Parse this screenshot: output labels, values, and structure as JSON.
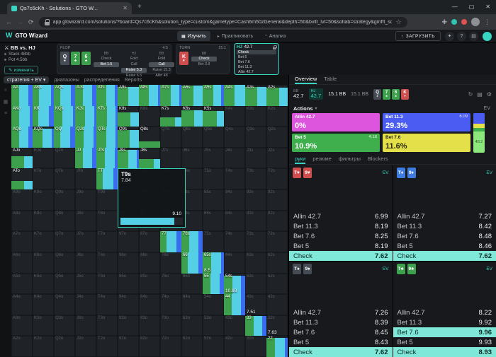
{
  "browser": {
    "tab_title": "Qs7c6cKh - Solutions - GTO W...",
    "new_tab_label": "+",
    "window_controls": [
      {
        "name": "minimize-button",
        "glyph": "—"
      },
      {
        "name": "maximize-button",
        "glyph": "▢"
      },
      {
        "name": "close-button",
        "glyph": "✕"
      }
    ],
    "nav_icons": [
      {
        "name": "back-icon",
        "glyph": "←",
        "dim": false
      },
      {
        "name": "forward-icon",
        "glyph": "→",
        "dim": true
      },
      {
        "name": "reload-icon",
        "glyph": "⟳",
        "dim": false
      }
    ],
    "url": "app.gtowizard.com/solutions/?board=Qs7c6cKh&solution_type=custom&gametype=Cash6m50zGeneral&depth=50&bvllt_lvl=50&soltab=strategy&gmfft_sort_key=f0&gmfft_sort_order=desc&custree_id=5ffed60e-3e62",
    "bookmark_icon": "☆",
    "menu_icon": "⋮",
    "extensions": [
      {
        "name": "extension-icon-teal",
        "color": "#2fc4b2"
      },
      {
        "name": "extension-icon-red",
        "color": "#e05252"
      }
    ]
  },
  "app_header": {
    "logo_letter": "W",
    "brand": "GTO Wizard",
    "nav": [
      {
        "label": "Изучить",
        "icon": "▦",
        "active": true
      },
      {
        "label": "Практиковать",
        "icon": "▸",
        "active": false
      },
      {
        "label": "Анализ",
        "icon": "◔",
        "active": false
      }
    ],
    "upload_label": "ЗАГРУЗИТЬ",
    "upload_icon": "↑",
    "icons": [
      {
        "name": "promo-icon",
        "glyph": "✦"
      },
      {
        "name": "help-icon",
        "glyph": "?"
      },
      {
        "name": "apps-icon",
        "glyph": "▤"
      }
    ]
  },
  "spot": {
    "matchup": {
      "title": "BB vs. HJ",
      "swords_icon": "⚔",
      "stack": "Stack 48bb",
      "pot": "Pot 4.5bb",
      "edit_label": "изменить",
      "edit_icon": "✎"
    },
    "flop": {
      "name": "FLOP",
      "pot": "4.5",
      "cards": [
        [
          "Q",
          "s"
        ],
        [
          "7",
          "c"
        ],
        [
          "6",
          "c"
        ]
      ],
      "columns": [
        {
          "player": "BB",
          "actions": [
            "Check",
            "Bet 1.5"
          ],
          "selected": 1
        },
        {
          "player": "HJ",
          "actions": [
            "Fold",
            "Call",
            "Raise 5.3",
            "Raise 6.5"
          ],
          "selected": 2
        },
        {
          "player": "BB",
          "actions": [
            "Fold",
            "Call",
            "Raise 15.3",
            "Allin 48"
          ],
          "selected": 1
        }
      ]
    },
    "turn": {
      "name": "TURN",
      "pot": "15.1",
      "cards": [
        [
          "K",
          "h"
        ]
      ],
      "columns": [
        {
          "player": "BB",
          "actions": [
            "Check",
            "Bet 3.8"
          ],
          "selected": 0
        }
      ]
    },
    "hero": {
      "player": "HJ",
      "stack": "42.7",
      "actions": [
        "Check",
        "Bet 5",
        "Bet 7.6",
        "Bet 11.3",
        "Allin 42.7"
      ],
      "hover": 0
    }
  },
  "left_tabs": [
    {
      "label": "стратегия + EV",
      "active": true,
      "caret": "▾"
    },
    {
      "label": "диапазоны",
      "active": false,
      "caret": ""
    },
    {
      "label": "распределения",
      "active": false,
      "caret": ""
    },
    {
      "label": "Reports",
      "active": false,
      "caret": ""
    }
  ],
  "side_icons": [
    {
      "name": "collapse-icon",
      "glyph": "«"
    },
    {
      "name": "grid-icon",
      "glyph": "▦"
    },
    {
      "name": "filter-icon",
      "glyph": "≡"
    }
  ],
  "matrix": {
    "ranks": [
      "A",
      "K",
      "Q",
      "J",
      "T",
      "9",
      "8",
      "7",
      "6",
      "5",
      "4",
      "3",
      "2"
    ],
    "selected": "T9s",
    "expanded": {
      "hand": "T9s",
      "ev_top": "7.84",
      "ev_bottom": "9.10"
    },
    "ev_labels": [
      {
        "hand": "55",
        "value": "8.5"
      },
      {
        "hand": "44",
        "value": "10.68"
      },
      {
        "hand": "33",
        "value": "7.51"
      },
      {
        "hand": "22",
        "value": "7.63"
      }
    ],
    "cells": {
      "AA": {
        "f": 100,
        "s": [
          [
            "g",
            35
          ],
          [
            "c",
            45
          ],
          [
            "b",
            20
          ]
        ]
      },
      "AKs": {
        "f": 100,
        "s": [
          [
            "g",
            30
          ],
          [
            "c",
            55
          ],
          [
            "b",
            15
          ]
        ]
      },
      "AQs": {
        "f": 100,
        "s": [
          [
            "g",
            30
          ],
          [
            "c",
            50
          ],
          [
            "b",
            20
          ]
        ]
      },
      "AJs": {
        "f": 100,
        "s": [
          [
            "g",
            35
          ],
          [
            "c",
            45
          ],
          [
            "b",
            20
          ]
        ]
      },
      "ATs": {
        "f": 100,
        "s": [
          [
            "g",
            45
          ],
          [
            "c",
            40
          ],
          [
            "b",
            15
          ]
        ]
      },
      "A9s": {
        "f": 90,
        "s": [
          [
            "g",
            50
          ],
          [
            "c",
            50
          ]
        ]
      },
      "A8s": {
        "f": 100,
        "s": [
          [
            "g",
            45
          ],
          [
            "c",
            45
          ],
          [
            "b",
            10
          ]
        ]
      },
      "A7s": {
        "f": 100,
        "s": [
          [
            "g",
            50
          ],
          [
            "c",
            40
          ],
          [
            "b",
            10
          ]
        ]
      },
      "A6s": {
        "f": 95,
        "s": [
          [
            "g",
            55
          ],
          [
            "c",
            45
          ]
        ]
      },
      "A5s": {
        "f": 100,
        "s": [
          [
            "g",
            50
          ],
          [
            "c",
            35
          ],
          [
            "b",
            15
          ]
        ]
      },
      "A4s": {
        "f": 100,
        "s": [
          [
            "g",
            50
          ],
          [
            "c",
            50
          ]
        ]
      },
      "A3s": {
        "f": 90,
        "s": [
          [
            "g",
            55
          ],
          [
            "c",
            45
          ]
        ]
      },
      "A2s": {
        "f": 85,
        "s": [
          [
            "g",
            60
          ],
          [
            "c",
            40
          ]
        ]
      },
      "AKo": {
        "f": 100,
        "s": [
          [
            "g",
            35
          ],
          [
            "c",
            50
          ],
          [
            "b",
            15
          ]
        ]
      },
      "KK": {
        "f": 100,
        "s": [
          [
            "g",
            25
          ],
          [
            "c",
            50
          ],
          [
            "b",
            25
          ]
        ]
      },
      "KQs": {
        "f": 100,
        "s": [
          [
            "g",
            40
          ],
          [
            "c",
            50
          ],
          [
            "b",
            10
          ]
        ]
      },
      "KJs": {
        "f": 100,
        "s": [
          [
            "g",
            45
          ],
          [
            "c",
            45
          ],
          [
            "b",
            10
          ]
        ]
      },
      "KTs": {
        "f": 100,
        "s": [
          [
            "g",
            50
          ],
          [
            "c",
            40
          ],
          [
            "b",
            10
          ]
        ]
      },
      "K9s": {
        "f": 70,
        "s": [
          [
            "g",
            60
          ],
          [
            "c",
            40
          ]
        ]
      },
      "K7s": {
        "f": 45,
        "s": [
          [
            "g",
            70
          ],
          [
            "c",
            30
          ]
        ]
      },
      "K6s": {
        "f": 80,
        "s": [
          [
            "g",
            60
          ],
          [
            "c",
            40
          ]
        ]
      },
      "K5s": {
        "f": 75,
        "s": [
          [
            "g",
            65
          ],
          [
            "c",
            35
          ]
        ]
      },
      "AQo": {
        "f": 100,
        "s": [
          [
            "g",
            35
          ],
          [
            "c",
            45
          ],
          [
            "b",
            20
          ]
        ]
      },
      "KQo": {
        "f": 90,
        "s": [
          [
            "g",
            45
          ],
          [
            "c",
            45
          ],
          [
            "b",
            10
          ]
        ]
      },
      "QQ": {
        "f": 100,
        "s": [
          [
            "g",
            30
          ],
          [
            "c",
            45
          ],
          [
            "b",
            25
          ]
        ]
      },
      "QJs": {
        "f": 100,
        "s": [
          [
            "g",
            40
          ],
          [
            "c",
            45
          ],
          [
            "b",
            15
          ]
        ]
      },
      "QTs": {
        "f": 100,
        "s": [
          [
            "g",
            45
          ],
          [
            "c",
            45
          ],
          [
            "b",
            10
          ]
        ]
      },
      "Q9s": {
        "f": 85,
        "s": [
          [
            "g",
            55
          ],
          [
            "c",
            45
          ]
        ]
      },
      "Q8s": {
        "f": 30,
        "s": [
          [
            "g",
            100
          ]
        ]
      },
      "AJo": {
        "f": 60,
        "s": [
          [
            "g",
            60
          ],
          [
            "c",
            40
          ]
        ]
      },
      "JJ": {
        "f": 100,
        "s": [
          [
            "g",
            35
          ],
          [
            "c",
            45
          ],
          [
            "b",
            20
          ]
        ]
      },
      "JTs": {
        "f": 100,
        "s": [
          [
            "g",
            40
          ],
          [
            "c",
            45
          ],
          [
            "b",
            15
          ]
        ]
      },
      "J9s": {
        "f": 90,
        "s": [
          [
            "g",
            50
          ],
          [
            "c",
            40
          ],
          [
            "b",
            10
          ]
        ]
      },
      "J8s": {
        "f": 45,
        "s": [
          [
            "g",
            70
          ],
          [
            "c",
            30
          ]
        ]
      },
      "ATo": {
        "f": 40,
        "s": [
          [
            "g",
            60
          ],
          [
            "c",
            40
          ]
        ]
      },
      "TT": {
        "f": 100,
        "s": [
          [
            "g",
            30
          ],
          [
            "c",
            50
          ],
          [
            "b",
            20
          ]
        ]
      },
      "77": {
        "f": 100,
        "s": [
          [
            "g",
            30
          ],
          [
            "c",
            45
          ],
          [
            "b",
            25
          ]
        ]
      },
      "76s": {
        "f": 100,
        "s": [
          [
            "g",
            35
          ],
          [
            "c",
            45
          ],
          [
            "b",
            20
          ]
        ]
      },
      "66": {
        "f": 100,
        "s": [
          [
            "g",
            30
          ],
          [
            "c",
            50
          ],
          [
            "b",
            20
          ]
        ]
      },
      "65s": {
        "f": 100,
        "s": [
          [
            "g",
            40
          ],
          [
            "c",
            45
          ],
          [
            "b",
            15
          ]
        ]
      },
      "55": {
        "f": 100,
        "s": [
          [
            "g",
            35
          ],
          [
            "c",
            45
          ],
          [
            "b",
            20
          ]
        ]
      },
      "54s": {
        "f": 90,
        "s": [
          [
            "g",
            40
          ],
          [
            "c",
            40
          ],
          [
            "b",
            20
          ]
        ]
      },
      "44": {
        "f": 100,
        "s": [
          [
            "g",
            35
          ],
          [
            "c",
            45
          ],
          [
            "b",
            20
          ]
        ]
      },
      "33": {
        "f": 95,
        "s": [
          [
            "g",
            40
          ],
          [
            "c",
            40
          ],
          [
            "b",
            20
          ]
        ]
      },
      "22": {
        "f": 90,
        "s": [
          [
            "g",
            40
          ],
          [
            "c",
            45
          ],
          [
            "b",
            15
          ]
        ]
      }
    }
  },
  "right_panel": {
    "tabs": [
      {
        "label": "Overview",
        "active": true
      },
      {
        "label": "Table",
        "active": false
      }
    ],
    "players": [
      {
        "pos": "BB",
        "stack": "42.7",
        "active": false
      },
      {
        "pos": "HJ",
        "stack": "42.7",
        "active": true
      }
    ],
    "stats": [
      "15.1 BB",
      "15.1 BB"
    ],
    "board": [
      [
        "Q",
        "s"
      ],
      [
        "7",
        "c"
      ],
      [
        "6",
        "c"
      ],
      [
        "K",
        "h"
      ]
    ],
    "spot_icons": [
      {
        "name": "refresh-icon",
        "glyph": "↻"
      },
      {
        "name": "list-icon",
        "glyph": "▤"
      },
      {
        "name": "settings-icon",
        "glyph": "⚙"
      }
    ],
    "actions": {
      "title": "Actions",
      "caret": "▾",
      "ev_label": "EV",
      "tiles": [
        {
          "name": "Allin 42.7",
          "freq": "0%",
          "ev": "",
          "color": "allin",
          "col": 0,
          "row": 0
        },
        {
          "name": "Bet 11.3",
          "freq": "29.3%",
          "ev": "6.09",
          "color": "bet113",
          "col": 1,
          "row": 0
        },
        {
          "name": "Bet 5",
          "freq": "10.9%",
          "ev": "4.18",
          "color": "bet5",
          "col": 0,
          "row": 1
        },
        {
          "name": "Bet 7.6",
          "freq": "11.6%",
          "ev": "",
          "color": "bet76",
          "col": 1,
          "row": 1
        }
      ],
      "strip": [
        {
          "color": "allin",
          "pct": 0.5,
          "label": ""
        },
        {
          "color": "bet113",
          "pct": 29.3,
          "label": ""
        },
        {
          "color": "bet76",
          "pct": 11.6,
          "label": ""
        },
        {
          "color": "bet5",
          "pct": 10.9,
          "label": ""
        },
        {
          "color": "check",
          "pct": 48.2,
          "label": "48.2"
        }
      ]
    },
    "hand_tabs": [
      {
        "label": "руки",
        "active": true
      },
      {
        "label": "резюме",
        "active": false
      },
      {
        "label": "фильтры",
        "active": false
      },
      {
        "label": "Blockers",
        "active": false
      }
    ],
    "hand_cards": [
      {
        "cards": [
          [
            "T",
            "h"
          ],
          [
            "9",
            "h"
          ]
        ],
        "ev_label": "EV",
        "rows": [
          [
            "Allin 42.7",
            "6.99",
            false
          ],
          [
            "Bet 11.3",
            "8.19",
            false
          ],
          [
            "Bet 7.6",
            "8.25",
            false
          ],
          [
            "Bet 5",
            "8.19",
            false
          ],
          [
            "Check",
            "7.62",
            true
          ]
        ]
      },
      {
        "cards": [
          [
            "T",
            "d"
          ],
          [
            "9",
            "d"
          ]
        ],
        "ev_label": "EV",
        "rows": [
          [
            "Allin 42.7",
            "7.27",
            false
          ],
          [
            "Bet 11.3",
            "8.42",
            false
          ],
          [
            "Bet 7.6",
            "8.48",
            false
          ],
          [
            "Bet 5",
            "8.46",
            false
          ],
          [
            "Check",
            "7.62",
            true
          ]
        ]
      },
      {
        "cards": [
          [
            "T",
            "s"
          ],
          [
            "9",
            "s"
          ]
        ],
        "ev_label": "EV",
        "rows": [
          [
            "Allin 42.7",
            "7.26",
            false
          ],
          [
            "Bet 11.3",
            "8.39",
            false
          ],
          [
            "Bet 7.6",
            "8.45",
            false
          ],
          [
            "Bet 5",
            "8.43",
            false
          ],
          [
            "Check",
            "7.62",
            true
          ]
        ]
      },
      {
        "cards": [
          [
            "T",
            "c"
          ],
          [
            "9",
            "c"
          ]
        ],
        "ev_label": "EV",
        "rows": [
          [
            "Allin 42.7",
            "8.22",
            false
          ],
          [
            "Bet 11.3",
            "9.92",
            false
          ],
          [
            "Bet 7.6",
            "9.96",
            true
          ],
          [
            "Bet 5",
            "9.93",
            false
          ],
          [
            "Check",
            "8.93",
            true
          ]
        ]
      }
    ]
  },
  "colors": {
    "accent": "#38d6c2",
    "allin": "#dd55dd",
    "bet113": "#4a5cf2",
    "bet76": "#e4e04a",
    "bet5": "#3fae4c",
    "check": "#8ce87c",
    "matrix_check": "#55cfe6",
    "matrix_green": "#3da04c",
    "matrix_blue": "#3a6cf0",
    "highlight": "#7fe8d8"
  },
  "suits": {
    "glyphs": {
      "s": "♠",
      "h": "♥",
      "d": "♦",
      "c": "♣"
    },
    "colors": {
      "s": "#454c55",
      "h": "#cf4f4f",
      "d": "#3f7ce0",
      "c": "#3da04c"
    }
  }
}
